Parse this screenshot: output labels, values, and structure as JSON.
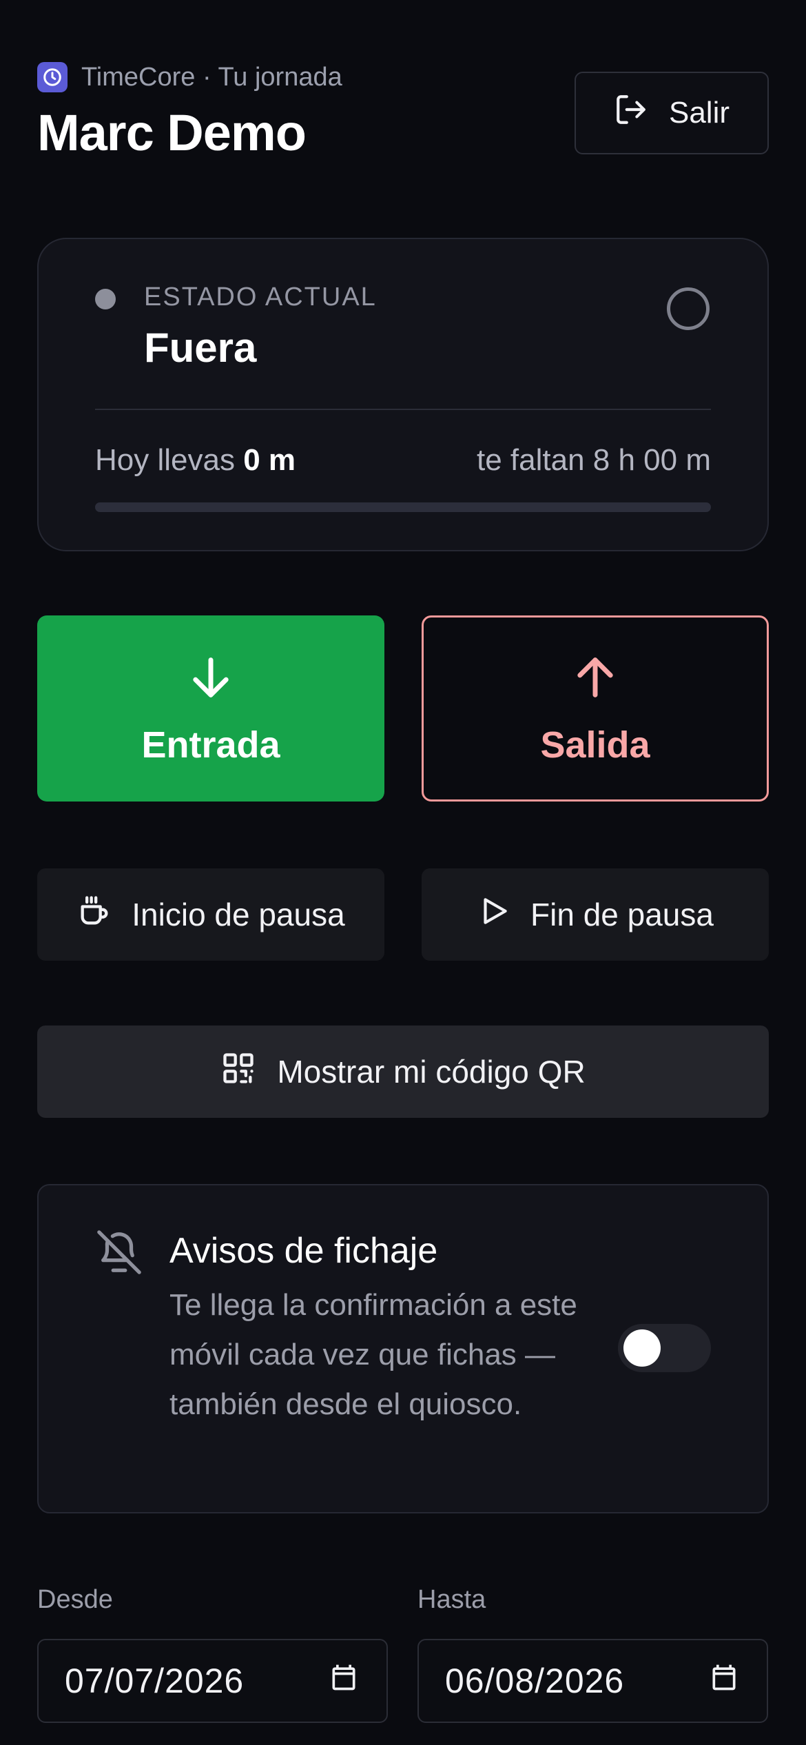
{
  "header": {
    "brand_text": "TimeCore · Tu jornada",
    "user_name": "Marc Demo",
    "logout_label": "Salir",
    "brand_color": "#5b5bd6"
  },
  "status": {
    "kicker": "ESTADO ACTUAL",
    "value": "Fuera",
    "today_prefix": "Hoy llevas",
    "today_value": "0 m",
    "remaining": "te faltan 8 h 00 m",
    "progress_fraction": 0
  },
  "actions": {
    "clock_in_label": "Entrada",
    "clock_out_label": "Salida",
    "break_start_label": "Inicio de pausa",
    "break_end_label": "Fin de pausa",
    "qr_label": "Mostrar mi código QR",
    "clock_in_color": "#16a34a",
    "clock_out_color": "#f49a9a"
  },
  "notifications": {
    "title": "Avisos de fichaje",
    "description": "Te llega la confirmación a este móvil cada vez que fichas — también desde el quiosco.",
    "enabled": false
  },
  "date_range": {
    "from_label": "Desde",
    "from_value": "07/07/2026",
    "to_label": "Hasta",
    "to_value": "06/08/2026"
  },
  "icons": {
    "brand": "clock-icon",
    "logout": "logout-icon",
    "status": "circle-outline-icon",
    "clock_in": "arrow-down-icon",
    "clock_out": "arrow-up-icon",
    "break_start": "coffee-icon",
    "break_end": "play-icon",
    "qr": "qr-code-icon",
    "notifications": "bell-off-icon",
    "calendar": "calendar-icon"
  }
}
